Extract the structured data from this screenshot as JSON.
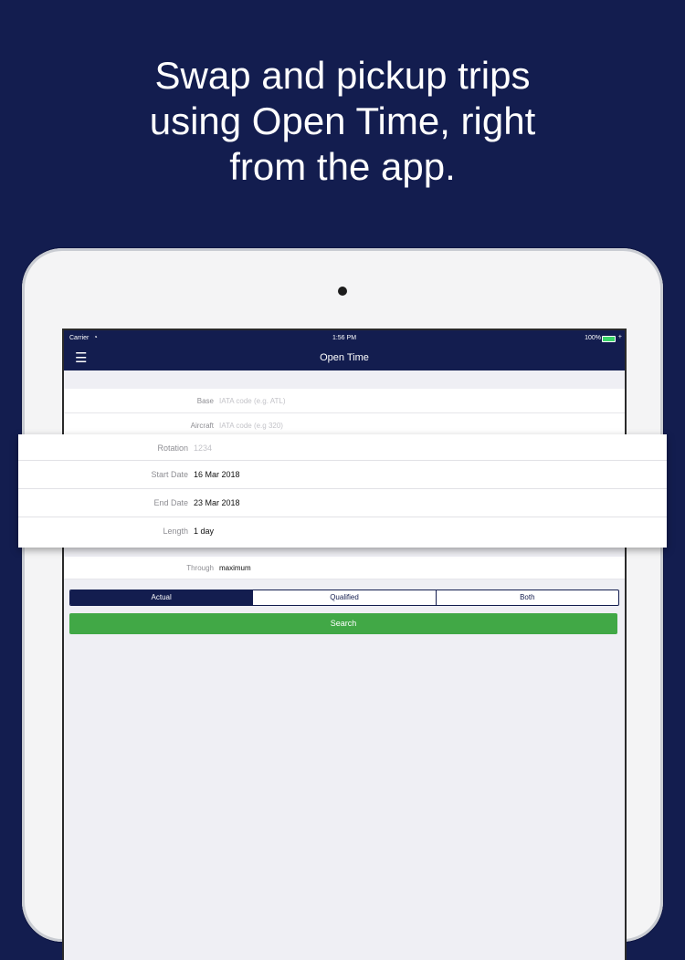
{
  "headline": {
    "line1": "Swap and pickup trips",
    "line2": "using Open Time, right",
    "line3": "from the app."
  },
  "status_bar": {
    "carrier": "Carrier",
    "time": "1:56 PM",
    "battery": "100%"
  },
  "nav": {
    "title": "Open Time",
    "menu_icon": "hamburger-menu-icon"
  },
  "form": {
    "base": {
      "label": "Base",
      "placeholder": "IATA code (e.g. ATL)"
    },
    "aircraft": {
      "label": "Aircraft",
      "placeholder": "IATA code (e.g 320)"
    },
    "rotation": {
      "label": "Rotation",
      "placeholder": "1234"
    },
    "start_date": {
      "label": "Start Date",
      "value": "16 Mar 2018"
    },
    "end_date": {
      "label": "End Date",
      "value": "23 Mar 2018"
    },
    "length": {
      "label": "Length",
      "value": "1 day"
    },
    "through": {
      "label": "Through",
      "value": "maximum"
    }
  },
  "segment": {
    "options": [
      "Actual",
      "Qualified",
      "Both"
    ],
    "selected": "Actual"
  },
  "search_button": "Search",
  "colors": {
    "navy": "#131d4f",
    "green": "#41a846",
    "background": "#efeff4"
  }
}
